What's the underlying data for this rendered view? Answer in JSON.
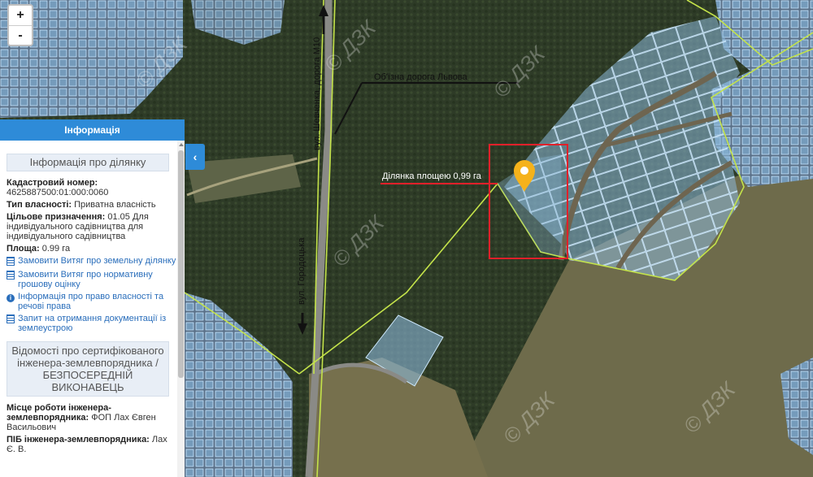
{
  "map": {
    "labels": {
      "bypass": "Об'їзна дорога Львова",
      "road_vertical": "вул. Шевченка, дорога М10",
      "road_lower": "вул. Городоцька",
      "plot": "Ділянка площею 0,99 га"
    },
    "watermark": "© ДЗК",
    "colors": {
      "forest": "#2f3d28",
      "field": "#6b6a4a",
      "parcel_fill": "#7fb7e6",
      "parcel_stroke": "#bfe3ff",
      "boundary": "#c4e34a",
      "highlight": "#e0202a",
      "marker": "#f5b21b"
    }
  },
  "zoom": {
    "in": "+",
    "out": "-"
  },
  "panel": {
    "header": "Інформація",
    "collapse_icon": "‹",
    "section_title": "Інформація про ділянку",
    "cadastral_label": "Кадастровий номер:",
    "cadastral_value": "4625887500:01:000:0060",
    "ownership_label": "Тип власності:",
    "ownership_value": "Приватна власність",
    "purpose_label": "Цільове призначення:",
    "purpose_value": "01.05 Для індивідуального садівництва для індивідуального садівництва",
    "area_label": "Площа:",
    "area_value": "0.99 га",
    "links": [
      "Замовити Витяг про земельну ділянку",
      "Замовити Витяг про нормативну грошову оцінку",
      "Інформація про право власності та речові права",
      "Запит на отримання документації із землеустрою"
    ],
    "engineer_title": "Відомості про сертифікованого інженера-землевпорядника / БЕЗПОСЕРЕДНІЙ ВИКОНАВЕЦЬ",
    "workplace_label": "Місце роботи інженера-землевпорядника:",
    "workplace_value": "ФОП Лах Євген Васильович",
    "name_label": "ПІБ інженера-землевпорядника:",
    "name_value": "Лах Є. В."
  }
}
